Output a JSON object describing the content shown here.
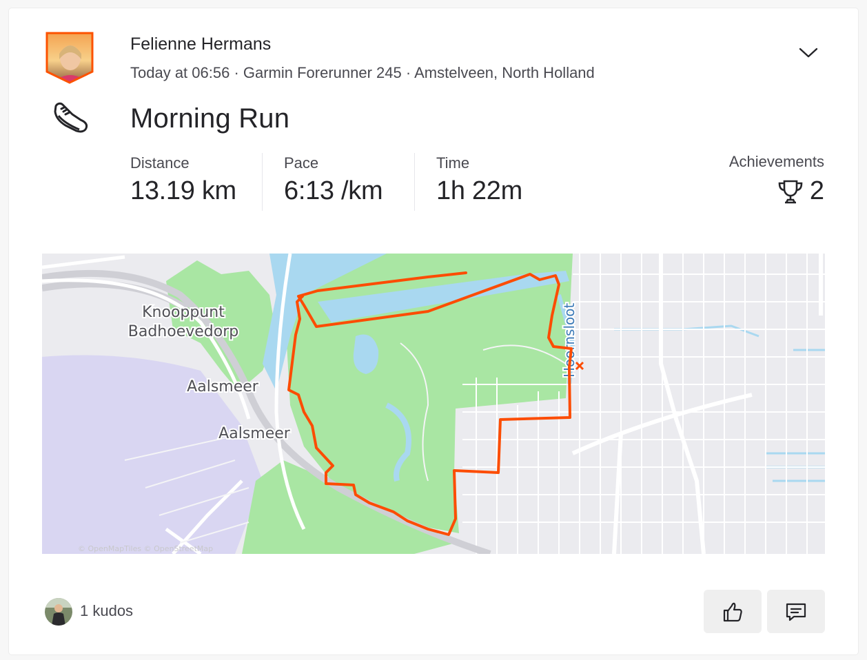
{
  "activity": {
    "athlete_name": "Felienne Hermans",
    "meta": "Today at 06:56 · Garmin Forerunner 245 · Amstelveen, North Holland",
    "title": "Morning Run",
    "sport_icon": "shoe-icon"
  },
  "stats": [
    {
      "label": "Distance",
      "value": "13.19 km"
    },
    {
      "label": "Pace",
      "value": "6:13 /km"
    },
    {
      "label": "Time",
      "value": "1h 22m"
    }
  ],
  "achievements": {
    "label": "Achievements",
    "count": "2",
    "icon": "trophy-icon"
  },
  "map": {
    "labels": {
      "knooppunt_1": "Knooppunt",
      "knooppunt_2": "Badhoevedorp",
      "aalsmeer_1": "Aalsmeer",
      "aalsmeer_2": "Aalsmeer",
      "hoornsloot": "Hoornsloot",
      "attribution": "© OpenMapTiles © OpenStreetMap"
    },
    "route_color": "#fc5200",
    "park_color": "#a9e6a3",
    "water_color": "#a9d8f0"
  },
  "footer": {
    "kudos_text": "1 kudos",
    "kudos_button_icon": "thumbs-up-icon",
    "comment_button_icon": "comment-icon"
  }
}
